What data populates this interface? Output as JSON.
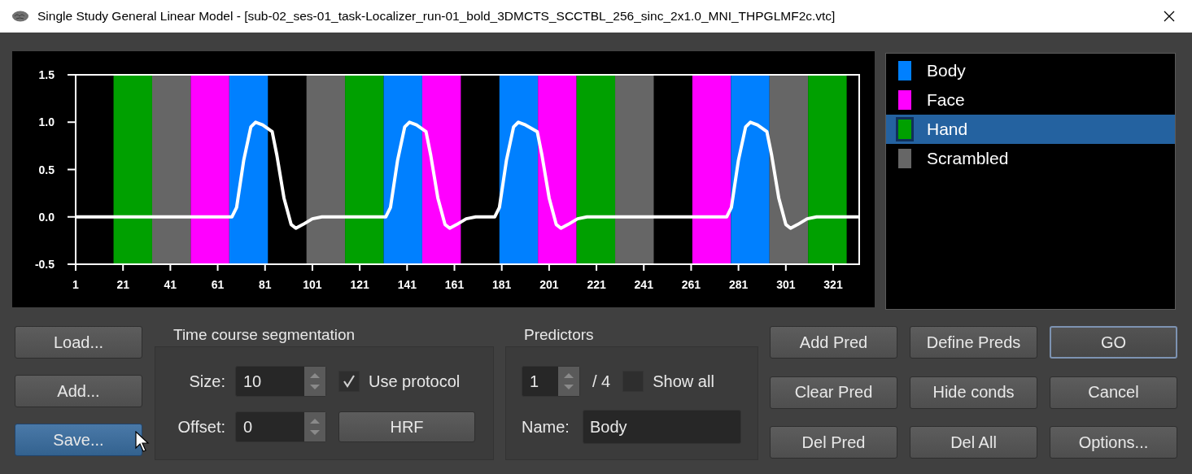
{
  "window": {
    "title": "Single Study General Linear Model - [sub-02_ses-01_task-Localizer_run-01_bold_3DMCTS_SCCTBL_256_sinc_2x1.0_MNI_THPGLMF2c.vtc]"
  },
  "chart": {
    "chart_data": {
      "xlim": [
        1,
        332
      ],
      "ylim": [
        -0.5,
        1.5
      ],
      "xticks": [
        1,
        21,
        41,
        61,
        81,
        101,
        121,
        141,
        161,
        181,
        201,
        221,
        241,
        261,
        281,
        301,
        321
      ],
      "yticks": [
        {
          "value": -0.5,
          "label": "-0.5"
        },
        {
          "value": 0,
          "label": "0.0"
        },
        {
          "value": 0.5,
          "label": "0.5"
        },
        {
          "value": 1,
          "label": "1.0"
        },
        {
          "value": 1.5,
          "label": "1.5"
        }
      ],
      "x": [
        1,
        67,
        69,
        72,
        75,
        77,
        80,
        84,
        86,
        89,
        92,
        94,
        97,
        101,
        105,
        132,
        134,
        137,
        140,
        142,
        145,
        149,
        151,
        154,
        157,
        159,
        162,
        166,
        170,
        178,
        180,
        183,
        186,
        188,
        191,
        196,
        198,
        201,
        204,
        206,
        209,
        213,
        217,
        276,
        278,
        281,
        284,
        286,
        289,
        293,
        295,
        298,
        301,
        303,
        306,
        310,
        314,
        332
      ],
      "series": [
        {
          "color": "#ffffff",
          "values": [
            0,
            0,
            0.1,
            0.6,
            0.95,
            1.0,
            0.97,
            0.9,
            0.65,
            0.2,
            -0.08,
            -0.12,
            -0.08,
            -0.02,
            0,
            0,
            0.1,
            0.6,
            0.95,
            1.0,
            0.97,
            0.9,
            0.65,
            0.2,
            -0.08,
            -0.12,
            -0.08,
            -0.02,
            0,
            0,
            0.1,
            0.6,
            0.95,
            1.0,
            0.97,
            0.9,
            0.65,
            0.2,
            -0.08,
            -0.12,
            -0.08,
            -0.02,
            0,
            0,
            0.1,
            0.6,
            0.95,
            1.0,
            0.97,
            0.9,
            0.65,
            0.2,
            -0.08,
            -0.12,
            -0.08,
            -0.02,
            0,
            0
          ]
        }
      ],
      "type": "line"
    },
    "protocol_blocks": [
      {
        "kind": "rest"
      },
      {
        "kind": "condition",
        "color": "#00a000"
      },
      {
        "kind": "condition",
        "color": "#666666"
      },
      {
        "kind": "condition",
        "color": "#ff00ff"
      },
      {
        "kind": "condition",
        "color": "#0080ff"
      },
      {
        "kind": "rest"
      },
      {
        "kind": "condition",
        "color": "#666666"
      },
      {
        "kind": "condition",
        "color": "#00a000"
      },
      {
        "kind": "condition",
        "color": "#0080ff"
      },
      {
        "kind": "condition",
        "color": "#ff00ff"
      },
      {
        "kind": "rest"
      },
      {
        "kind": "condition",
        "color": "#0080ff"
      },
      {
        "kind": "condition",
        "color": "#ff00ff"
      },
      {
        "kind": "condition",
        "color": "#00a000"
      },
      {
        "kind": "condition",
        "color": "#666666"
      },
      {
        "kind": "rest"
      },
      {
        "kind": "condition",
        "color": "#ff00ff"
      },
      {
        "kind": "condition",
        "color": "#0080ff"
      },
      {
        "kind": "condition",
        "color": "#666666"
      },
      {
        "kind": "condition",
        "color": "#00a000"
      },
      {
        "kind": "rest"
      }
    ]
  },
  "legend": {
    "items": [
      {
        "label": "Body",
        "color": "#0080ff",
        "selected": false
      },
      {
        "label": "Face",
        "color": "#ff00ff",
        "selected": false
      },
      {
        "label": "Hand",
        "color": "#00a000",
        "selected": true
      },
      {
        "label": "Scrambled",
        "color": "#666666",
        "selected": false
      }
    ]
  },
  "file_buttons": [
    {
      "label": "Load...",
      "hovered": false
    },
    {
      "label": "Add...",
      "hovered": false
    },
    {
      "label": "Save...",
      "hovered": true
    }
  ],
  "segmentation": {
    "title": "Time course segmentation",
    "size": {
      "label": "Size:",
      "value": "10"
    },
    "offset": {
      "label": "Offset:",
      "value": "0"
    },
    "use_protocol": {
      "label": "Use protocol",
      "checked": true
    },
    "hrf_button": "HRF"
  },
  "predictors": {
    "title": "Predictors",
    "current": "1",
    "total": "/ 4",
    "show_all": {
      "label": "Show all",
      "checked": false
    },
    "name": {
      "label": "Name:",
      "value": "Body"
    }
  },
  "buttons": [
    {
      "label": "Add Pred",
      "default": false
    },
    {
      "label": "Define Preds",
      "default": false
    },
    {
      "label": "GO",
      "default": true
    },
    {
      "label": "Clear Pred",
      "default": false
    },
    {
      "label": "Hide conds",
      "default": false
    },
    {
      "label": "Cancel",
      "default": false
    },
    {
      "label": "Del Pred",
      "default": false
    },
    {
      "label": "Del All",
      "default": false
    },
    {
      "label": "Options...",
      "default": false
    }
  ]
}
